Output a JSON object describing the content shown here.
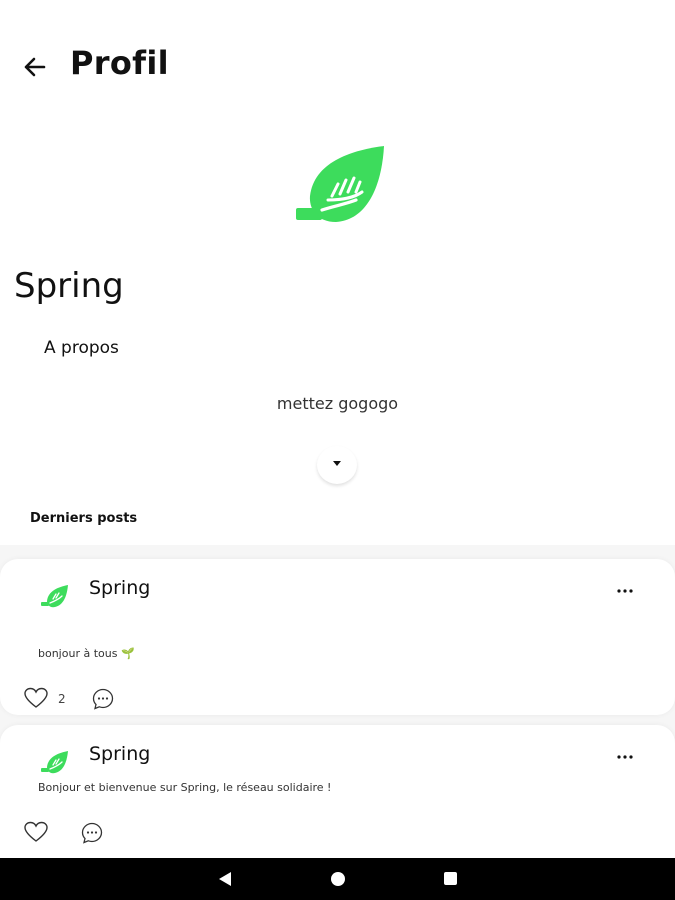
{
  "header": {
    "title": "Profil",
    "back_icon": "arrow-left-icon"
  },
  "profile": {
    "logo_icon": "leaf-hand-icon",
    "name": "Spring",
    "about_title": "A propos",
    "about_text": "mettez gogogo",
    "expand_icon": "caret-down-icon"
  },
  "posts_section": {
    "title": "Derniers posts",
    "posts": [
      {
        "author": "Spring",
        "text": "bonjour à tous 🌱",
        "likes": "2"
      },
      {
        "author": "Spring",
        "text": "Bonjour et bienvenue sur Spring, le réseau solidaire !",
        "likes": ""
      }
    ]
  },
  "colors": {
    "brand_green": "#3ddc5c",
    "navbar": "#000000",
    "feed_bg": "#f6f6f6"
  },
  "system_nav": {
    "icons": [
      "nav-back-icon",
      "nav-home-icon",
      "nav-recents-icon"
    ]
  }
}
